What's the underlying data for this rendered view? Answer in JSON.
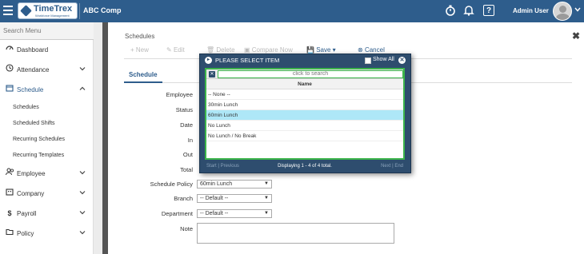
{
  "topbar": {
    "company": "ABC Comp",
    "logo_text": "TimeTrex",
    "logo_sub": "Workforce Management",
    "user": "Admin User",
    "help_glyph": "?",
    "icons": [
      "hamburger-icon",
      "timer-icon",
      "bell-icon",
      "help-icon",
      "avatar",
      "chevron-down-icon"
    ]
  },
  "sidebar": {
    "search_placeholder": "Search Menu",
    "items": [
      {
        "label": "Dashboard",
        "icon": "dashboard-icon"
      },
      {
        "label": "Attendance",
        "icon": "clock-icon"
      },
      {
        "label": "Schedule",
        "icon": "calendar-icon"
      },
      {
        "label": "Employee",
        "icon": "users-icon"
      },
      {
        "label": "Company",
        "icon": "building-icon"
      },
      {
        "label": "Payroll",
        "icon": "dollar-icon"
      },
      {
        "label": "Policy",
        "icon": "folder-icon"
      }
    ],
    "sub_items": [
      "Schedules",
      "Scheduled Shifts",
      "Recurring Schedules",
      "Recurring Templates"
    ]
  },
  "main": {
    "title": "Schedules",
    "toolbar": {
      "new": "New",
      "edit": "Edit",
      "delete": "Delete",
      "compare": "Compare Now",
      "save": "Save",
      "cancel": "Cancel"
    },
    "tab": "Schedule",
    "labels": {
      "employee": "Employee",
      "status": "Status",
      "date": "Date",
      "in": "In",
      "out": "Out",
      "total": "Total",
      "schedule_policy": "Schedule Policy",
      "branch": "Branch",
      "department": "Department",
      "note": "Note"
    },
    "values": {
      "schedule_policy": "60min Lunch",
      "branch": "-- Default --",
      "department": "-- Default --"
    }
  },
  "modal": {
    "title": "PLEASE SELECT ITEM",
    "show_all": "Show All",
    "search_placeholder": "click to search",
    "column": "Name",
    "rows": [
      "-- None --",
      "30min Lunch",
      "60min Lunch",
      "No Lunch",
      "No Lunch / No Break"
    ],
    "selected_index": 2,
    "footer_left": "Start | Previous",
    "status": "Displaying 1 - 4 of 4 total.",
    "footer_right": "Next | End",
    "colors": {
      "header": "#2e4d6e",
      "border": "#3cb44b",
      "selected": "#aee7f7"
    }
  },
  "colors": {
    "brand": "#2e5d8c"
  }
}
